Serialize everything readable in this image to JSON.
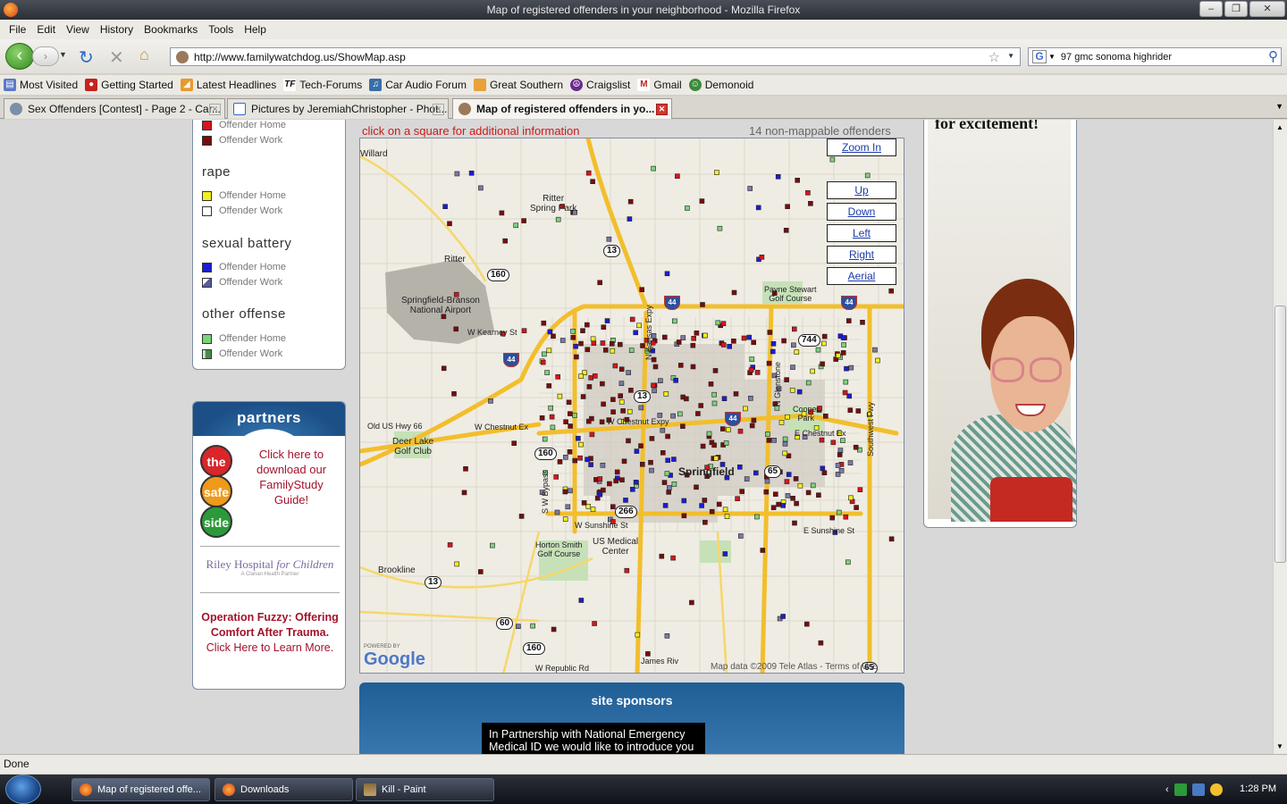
{
  "window": {
    "title": "Map of registered offenders in your neighborhood - Mozilla Firefox"
  },
  "menu": [
    "File",
    "Edit",
    "View",
    "History",
    "Bookmarks",
    "Tools",
    "Help"
  ],
  "nav": {
    "url": "http://www.familywatchdog.us/ShowMap.asp",
    "search_value": "97 gmc sonoma highrider"
  },
  "bookmarks": [
    {
      "label": "Most Visited",
      "icon": "folder-icon",
      "color": "#5a7ac4"
    },
    {
      "label": "Getting Started",
      "icon": "firefox-red-icon",
      "color": "#c4241c"
    },
    {
      "label": "Latest Headlines",
      "icon": "rss-icon",
      "color": "#e89a2a"
    },
    {
      "label": "Tech-Forums",
      "icon": "tf-icon",
      "color": "#111111"
    },
    {
      "label": "Car Audio Forum",
      "icon": "car-audio-icon",
      "color": "#3a6ea8"
    },
    {
      "label": "Great Southern",
      "icon": "great-southern-icon",
      "color": "#e8a23a"
    },
    {
      "label": "Craigslist",
      "icon": "peace-icon",
      "color": "#6a2a8a"
    },
    {
      "label": "Gmail",
      "icon": "gmail-icon",
      "color": "#c4241c"
    },
    {
      "label": "Demonoid",
      "icon": "demonoid-icon",
      "color": "#3c8a3c"
    }
  ],
  "tabs": [
    {
      "label": "Sex Offenders [Contest] - Page 2 - Car..."
    },
    {
      "label": "Pictures by JeremiahChristopher - Phot..."
    },
    {
      "label": "Map of registered offenders in yo..."
    }
  ],
  "legend": {
    "top_items": [
      "Offender Home",
      "Offender Work"
    ],
    "sections": [
      {
        "title": "rape",
        "items": [
          "Offender Home",
          "Offender Work"
        ]
      },
      {
        "title": "sexual battery",
        "items": [
          "Offender Home",
          "Offender Work"
        ]
      },
      {
        "title": "other offense",
        "items": [
          "Offender Home",
          "Offender Work"
        ]
      }
    ]
  },
  "partners": {
    "title": "partners",
    "logo": [
      "the",
      "safe",
      "side"
    ],
    "link_text": "Click here to download our FamilyStudy Guide!",
    "riley": "Riley Hospital",
    "riley_for": "for Children",
    "riley_sub": "A Clarian Health Partner",
    "fuzzy_title": "Operation Fuzzy: Offering Comfort After Trauma.",
    "fuzzy_link": "Click Here to Learn More."
  },
  "map": {
    "info": "click on a square for additional information",
    "nonmappable": "14 non-mappable offenders",
    "buttons": [
      "Zoom In",
      "Up",
      "Down",
      "Left",
      "Right",
      "Aerial"
    ],
    "labels": {
      "willard": "Willard",
      "ritter_park": "Ritter\nSpring Park",
      "ritter": "Ritter",
      "airport": "Springfield-Branson\nNational Airport",
      "kearney": "W Kearney St",
      "golf": "Payne Stewart\nGolf Course",
      "old_hwy": "Old US Hwy 66",
      "deer_lake": "Deer Lake\nGolf Club",
      "chestnut_w": "W Chestnut Ex",
      "chestnut": "W Chestnut Expy",
      "chestnut_e": "E Chestnut Ex",
      "cooper": "Cooper\nPark",
      "springfield": "Springfield",
      "sunshine_w": "W Sunshine St",
      "sunshine_e": "E Sunshine St",
      "horton": "Horton Smith\nGolf Course",
      "us_medical": "US Medical\nCenter",
      "brookline": "Brookline",
      "republic": "W Republic Rd",
      "james_river": "James Riv",
      "kansas": "N Kansas Expy",
      "glenstone": "N Glenstone",
      "bypass": "S W Bypass",
      "southwest_fwy": "Southwest Fwy",
      "powered": "POWERED BY",
      "google": "Google",
      "mapdata": "Map data ©2009 Tele Atlas - Terms of Use"
    },
    "shields": [
      "13",
      "160",
      "744",
      "13",
      "160",
      "266",
      "65",
      "13",
      "60",
      "160",
      "65"
    ],
    "interstates": [
      "44",
      "44",
      "44",
      "44"
    ]
  },
  "sponsors": {
    "title": "site sponsors",
    "text": "In Partnership with National Emergency Medical ID we would like to introduce you"
  },
  "ad": {
    "headline": "for excitement!"
  },
  "status": "Done",
  "taskbar": {
    "items": [
      "Map of registered offe...",
      "Downloads",
      "Kill - Paint"
    ],
    "time": "1:28 PM"
  },
  "colors": {
    "offender_home_top": "#d8141c",
    "offender_work_top": "#7a0c0c",
    "rape_home": "#f2f01c",
    "rape_work": "#ffffff",
    "battery_home": "#1c1cd8",
    "battery_work": "#7a7aa8",
    "other_home": "#7ad47a",
    "other_work": "#4a8a4a",
    "highway": "#f2be2c"
  }
}
